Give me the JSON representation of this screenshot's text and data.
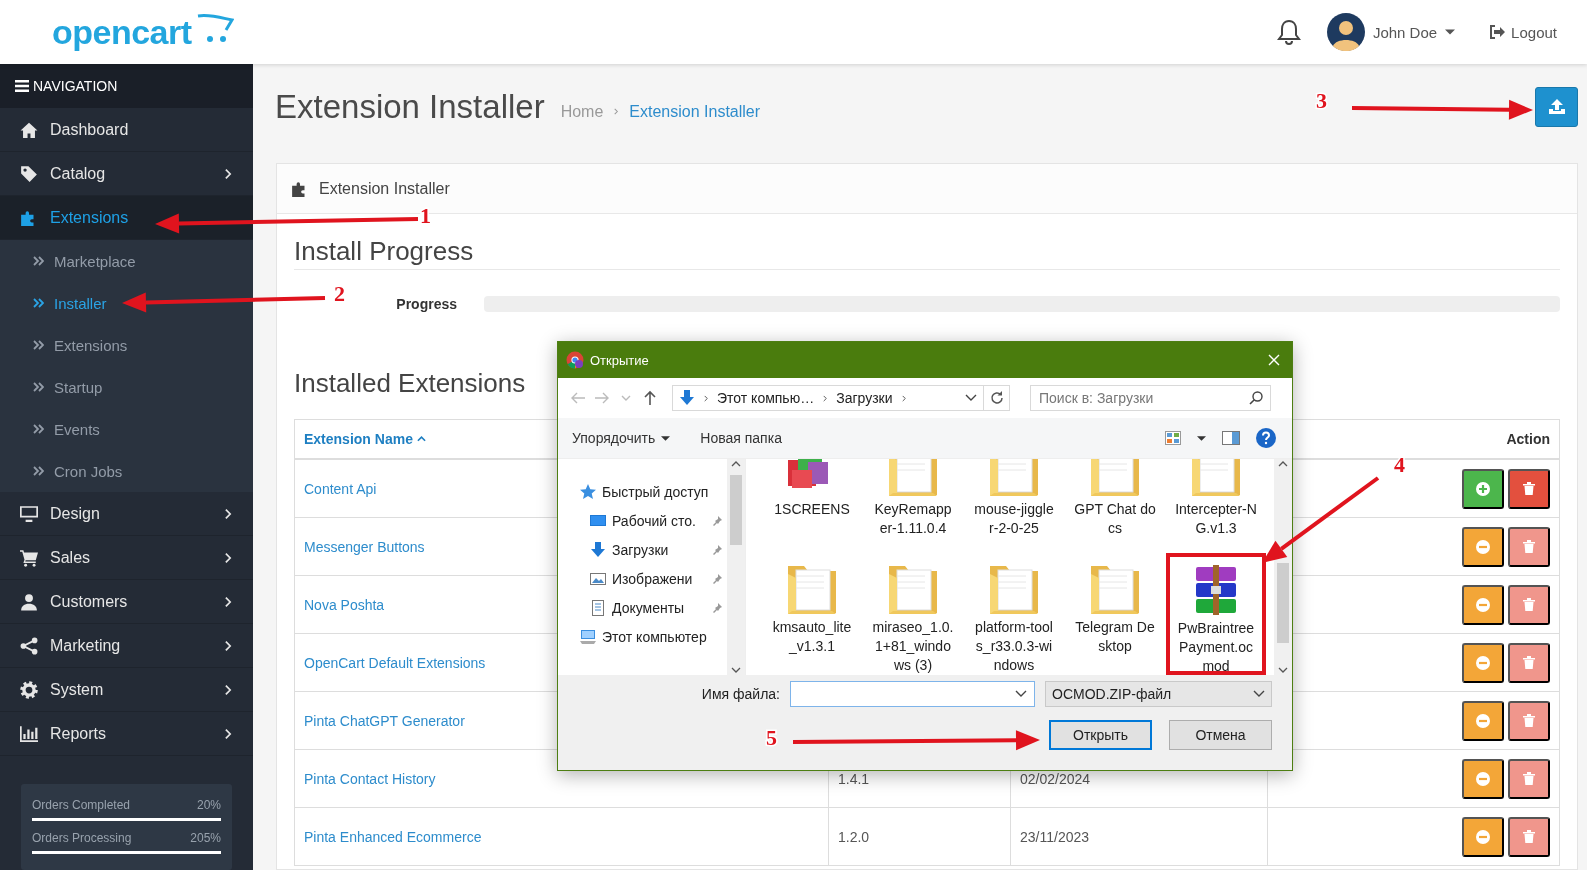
{
  "header": {
    "logo": "opencart",
    "user_name": "John Doe",
    "logout": "Logout"
  },
  "sidebar": {
    "title": "NAVIGATION",
    "items": [
      {
        "label": "Dashboard",
        "chevron": false,
        "selected": false
      },
      {
        "label": "Catalog",
        "chevron": true,
        "selected": false
      },
      {
        "label": "Extensions",
        "chevron": false,
        "selected": true,
        "children": [
          {
            "label": "Marketplace",
            "selected": false
          },
          {
            "label": "Installer",
            "selected": true
          },
          {
            "label": "Extensions",
            "selected": false
          },
          {
            "label": "Startup",
            "selected": false
          },
          {
            "label": "Events",
            "selected": false
          },
          {
            "label": "Cron Jobs",
            "selected": false
          }
        ]
      },
      {
        "label": "Design",
        "chevron": true,
        "selected": false
      },
      {
        "label": "Sales",
        "chevron": true,
        "selected": false
      },
      {
        "label": "Customers",
        "chevron": true,
        "selected": false
      },
      {
        "label": "Marketing",
        "chevron": true,
        "selected": false
      },
      {
        "label": "System",
        "chevron": true,
        "selected": false
      },
      {
        "label": "Reports",
        "chevron": true,
        "selected": false
      }
    ],
    "stats": [
      {
        "label": "Orders Completed",
        "value": "20%",
        "level": 1
      },
      {
        "label": "Orders Processing",
        "value": "205%",
        "level": 1
      }
    ]
  },
  "page": {
    "title": "Extension Installer",
    "breadcrumbs": [
      {
        "label": "Home",
        "current": false
      },
      {
        "label": "Extension Installer",
        "current": true
      }
    ]
  },
  "panel": {
    "title": "Extension Installer",
    "progress_heading": "Install Progress",
    "progress_label": "Progress",
    "progress": {
      "level": 0
    },
    "installed_heading": "Installed Extensions",
    "table": {
      "name_header": "Extension Name",
      "name_sorted": true,
      "action_header": "Action",
      "rows": [
        {
          "name": "Content Api",
          "installed": false
        },
        {
          "name": "Messenger Buttons",
          "installed": true
        },
        {
          "name": "Nova Poshta",
          "installed": true
        },
        {
          "name": "OpenCart Default Extensions",
          "installed": true
        },
        {
          "name": "Pinta ChatGPT Generator",
          "installed": true
        },
        {
          "name": "Pinta Contact History",
          "version": "1.4.1",
          "date": "02/02/2024",
          "installed": true
        },
        {
          "name": "Pinta Enhanced Ecommerce",
          "version": "1.2.0",
          "date": "23/11/2023",
          "installed": true
        }
      ]
    }
  },
  "dialog": {
    "title": "Открытие",
    "path": [
      "Этот компью…",
      "Загрузки"
    ],
    "search_placeholder": "Поиск в: Загрузки",
    "organize": "Упорядочить",
    "new_folder": "Новая папка",
    "tree": [
      {
        "label": "Быстрый доступ",
        "children": [
          {
            "label": "Рабочий сто.",
            "pinned": true
          },
          {
            "label": "Загрузки",
            "pinned": true
          },
          {
            "label": "Изображени",
            "pinned": true
          },
          {
            "label": "Документы",
            "pinned": true
          }
        ]
      },
      {
        "label": "Этот компьютер"
      }
    ],
    "files": [
      {
        "name": "1SCREENS",
        "kind": "app",
        "highlighted": false
      },
      {
        "name": "KeyRemapper-1.11.0.4",
        "kind": "folder",
        "highlighted": false
      },
      {
        "name": "mouse-jiggler-2-0-25",
        "kind": "folder",
        "highlighted": false
      },
      {
        "name": "GPT Chat docs",
        "kind": "folder",
        "highlighted": false
      },
      {
        "name": "Intercepter-NG.v1.3",
        "kind": "folder",
        "highlighted": false
      },
      {
        "name": "kmsauto_lite_v1.3.1",
        "kind": "folder",
        "highlighted": false
      },
      {
        "name": "miraseo_1.0.1+81_windows (3)",
        "kind": "folder",
        "highlighted": false
      },
      {
        "name": "platform-tools_r33.0.3-windows",
        "kind": "folder",
        "highlighted": false
      },
      {
        "name": "Telegram Desktop",
        "kind": "folder",
        "highlighted": false
      },
      {
        "name": "PwBraintreePayment.ocmod",
        "kind": "archive",
        "highlighted": true
      }
    ],
    "filename_label": "Имя файла:",
    "file_type": "OCMOD.ZIP-файл",
    "buttons": [
      {
        "label": "Открыть",
        "focused": true
      },
      {
        "label": "Отмена",
        "focused": false
      }
    ]
  },
  "annotations": [
    {
      "label": "1"
    },
    {
      "label": "2"
    },
    {
      "label": "3"
    },
    {
      "label": "4"
    },
    {
      "label": "5"
    }
  ]
}
